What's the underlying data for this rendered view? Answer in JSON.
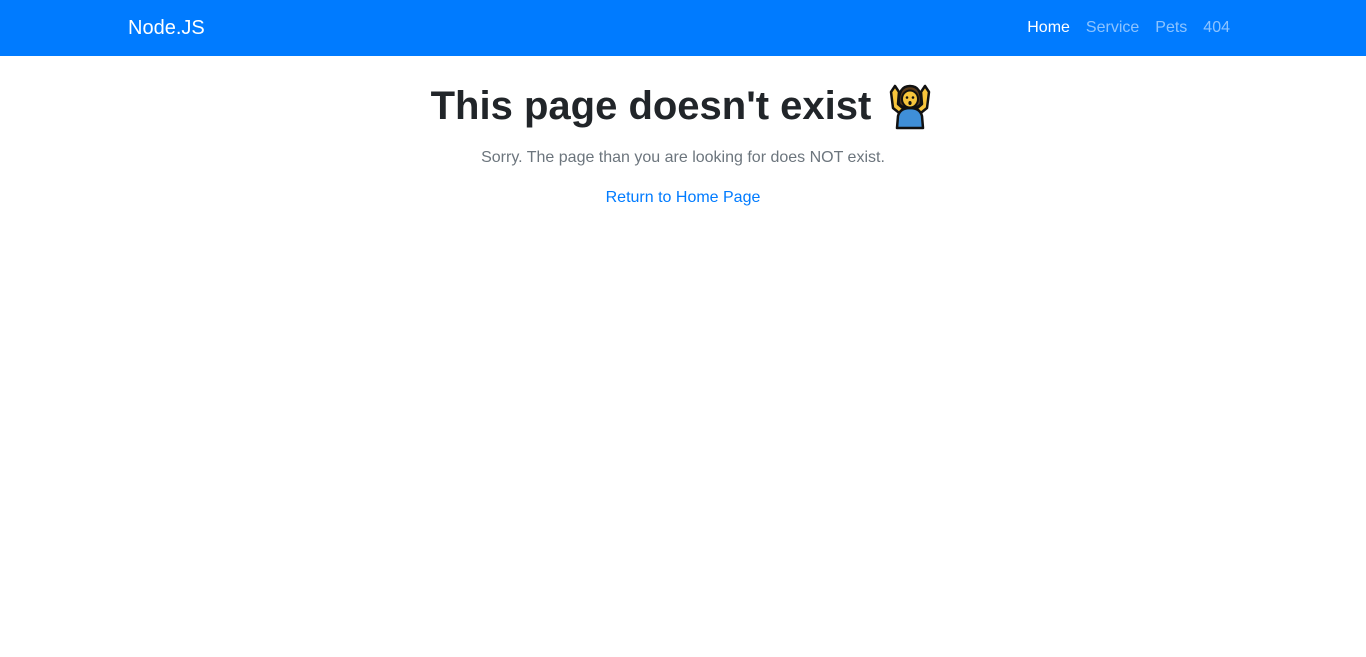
{
  "navbar": {
    "brand": "Node.JS",
    "links": [
      {
        "label": "Home",
        "active": true
      },
      {
        "label": "Service",
        "active": false
      },
      {
        "label": "Pets",
        "active": false
      },
      {
        "label": "404",
        "active": false
      }
    ]
  },
  "main": {
    "title": "This page doesn't exist",
    "title_icon": "person-shrugging-icon",
    "subtitle": "Sorry. The page than you are looking for does NOT exist.",
    "home_link": "Return to Home Page"
  },
  "colors": {
    "navbar_bg": "#007bff",
    "link": "#007bff",
    "heading": "#212529",
    "muted": "#6c757d"
  }
}
